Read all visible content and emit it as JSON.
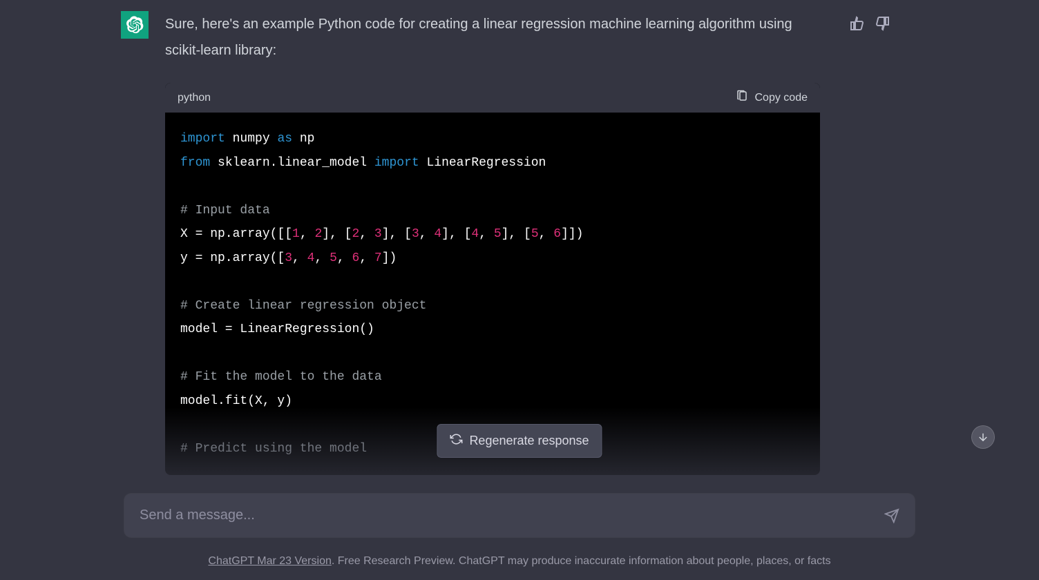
{
  "message": {
    "text": "Sure, here's an example Python code for creating a linear regression machine learning algorithm using scikit-learn library:"
  },
  "code": {
    "language": "python",
    "copy_label": "Copy code",
    "tokens": [
      {
        "t": "import",
        "c": "kw"
      },
      {
        "t": " numpy "
      },
      {
        "t": "as",
        "c": "kw"
      },
      {
        "t": " np\n"
      },
      {
        "t": "from",
        "c": "kw"
      },
      {
        "t": " sklearn.linear_model "
      },
      {
        "t": "import",
        "c": "kw"
      },
      {
        "t": " LinearRegression\n"
      },
      {
        "t": "\n"
      },
      {
        "t": "# Input data",
        "c": "cmt"
      },
      {
        "t": "\n"
      },
      {
        "t": "X = np.array([["
      },
      {
        "t": "1",
        "c": "num"
      },
      {
        "t": ", "
      },
      {
        "t": "2",
        "c": "num"
      },
      {
        "t": "], ["
      },
      {
        "t": "2",
        "c": "num"
      },
      {
        "t": ", "
      },
      {
        "t": "3",
        "c": "num"
      },
      {
        "t": "], ["
      },
      {
        "t": "3",
        "c": "num"
      },
      {
        "t": ", "
      },
      {
        "t": "4",
        "c": "num"
      },
      {
        "t": "], ["
      },
      {
        "t": "4",
        "c": "num"
      },
      {
        "t": ", "
      },
      {
        "t": "5",
        "c": "num"
      },
      {
        "t": "], ["
      },
      {
        "t": "5",
        "c": "num"
      },
      {
        "t": ", "
      },
      {
        "t": "6",
        "c": "num"
      },
      {
        "t": "]])\n"
      },
      {
        "t": "y = np.array(["
      },
      {
        "t": "3",
        "c": "num"
      },
      {
        "t": ", "
      },
      {
        "t": "4",
        "c": "num"
      },
      {
        "t": ", "
      },
      {
        "t": "5",
        "c": "num"
      },
      {
        "t": ", "
      },
      {
        "t": "6",
        "c": "num"
      },
      {
        "t": ", "
      },
      {
        "t": "7",
        "c": "num"
      },
      {
        "t": "])\n"
      },
      {
        "t": "\n"
      },
      {
        "t": "# Create linear regression object",
        "c": "cmt"
      },
      {
        "t": "\n"
      },
      {
        "t": "model = LinearRegression()\n"
      },
      {
        "t": "\n"
      },
      {
        "t": "# Fit the model to the data",
        "c": "cmt"
      },
      {
        "t": "\n"
      },
      {
        "t": "model.fit(X, y)\n"
      },
      {
        "t": "\n"
      },
      {
        "t": "# Predict using the model",
        "c": "cmt"
      }
    ]
  },
  "controls": {
    "regenerate_label": "Regenerate response"
  },
  "input": {
    "placeholder": "Send a message..."
  },
  "footer": {
    "version_label": "ChatGPT Mar 23 Version",
    "disclaimer": ". Free Research Preview. ChatGPT may produce inaccurate information about people, places, or facts"
  }
}
